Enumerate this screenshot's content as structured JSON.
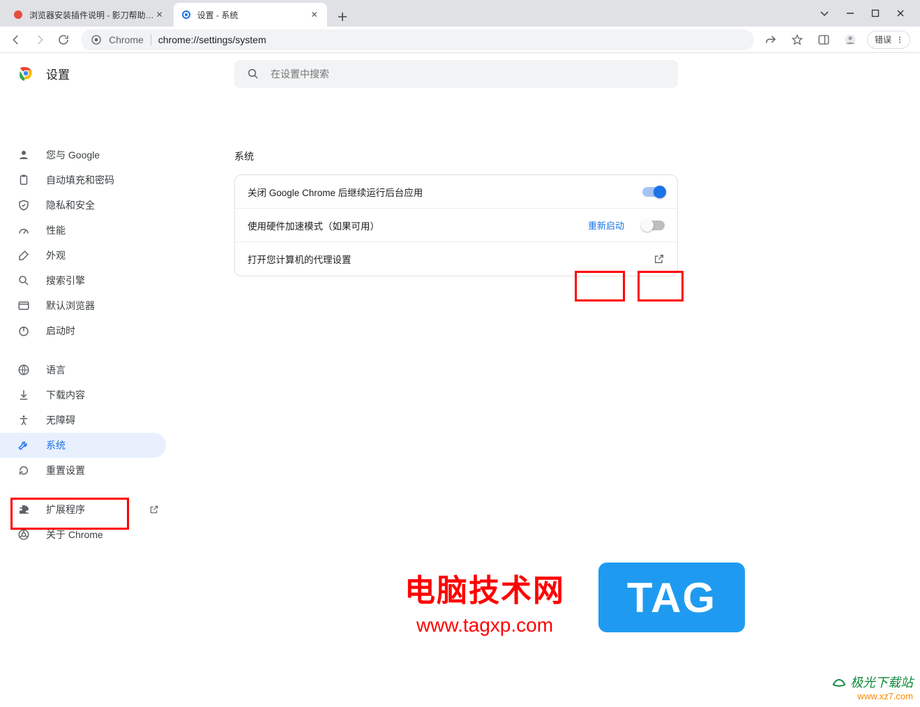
{
  "window": {
    "tabs": [
      {
        "title": "浏览器安装插件说明 - 影刀帮助…",
        "favicon": "yingdao"
      },
      {
        "title": "设置 - 系统",
        "favicon": "gear"
      }
    ],
    "new_tab": "+"
  },
  "toolbar": {
    "omnibox_prefix": "Chrome",
    "url": "chrome://settings/system",
    "error_chip": "错误"
  },
  "settings": {
    "header_title": "设置",
    "search_placeholder": "在设置中搜索",
    "sidebar": [
      {
        "icon": "person",
        "label": "您与 Google"
      },
      {
        "icon": "clipboard",
        "label": "自动填充和密码"
      },
      {
        "icon": "shield",
        "label": "隐私和安全"
      },
      {
        "icon": "speed",
        "label": "性能"
      },
      {
        "icon": "paint",
        "label": "外观"
      },
      {
        "icon": "search",
        "label": "搜索引擎"
      },
      {
        "icon": "browser",
        "label": "默认浏览器"
      },
      {
        "icon": "power",
        "label": "启动时"
      }
    ],
    "sidebar2": [
      {
        "icon": "globe",
        "label": "语言"
      },
      {
        "icon": "download",
        "label": "下载内容"
      },
      {
        "icon": "a11y",
        "label": "无障碍"
      },
      {
        "icon": "wrench",
        "label": "系统",
        "selected": true
      },
      {
        "icon": "reset",
        "label": "重置设置"
      }
    ],
    "sidebar3": [
      {
        "icon": "puzzle",
        "label": "扩展程序",
        "external": true
      },
      {
        "icon": "chrome",
        "label": "关于 Chrome"
      }
    ],
    "section_title": "系统",
    "rows": {
      "row1_label": "关闭 Google Chrome 后继续运行后台应用",
      "row1_toggle": "on",
      "row2_label": "使用硬件加速模式（如果可用）",
      "row2_action": "重新启动",
      "row2_toggle": "off",
      "row3_label": "打开您计算机的代理设置"
    }
  },
  "watermark": {
    "line1": "电脑技术网",
    "line2": "www.tagxp.com",
    "tag": "TAG",
    "site_name": "极光下载站",
    "site_url": "www.xz7.com"
  }
}
